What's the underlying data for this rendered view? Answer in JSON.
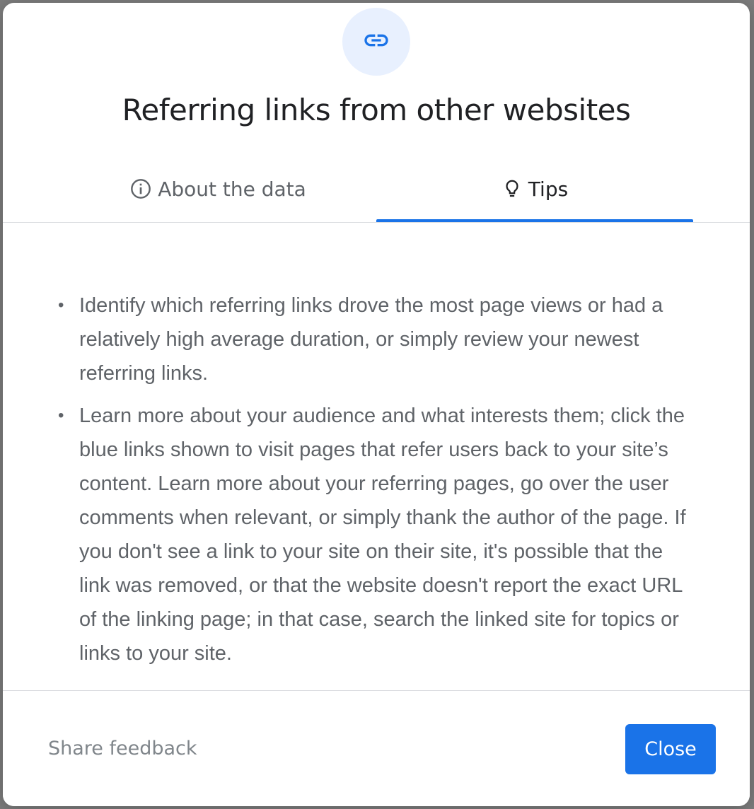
{
  "dialog": {
    "title": "Referring links from other websites",
    "header_icon": "link-icon",
    "accent_color": "#1a73e8",
    "icon_bg_color": "#e8f0fe"
  },
  "tabs": [
    {
      "label": "About the data",
      "icon": "info-icon",
      "selected": false
    },
    {
      "label": "Tips",
      "icon": "lightbulb-icon",
      "selected": true
    }
  ],
  "tips": [
    "Identify which referring links drove the most page views or had a relatively high average duration, or simply review your newest referring links.",
    "Learn more about your audience and what interests them; click the blue links shown to visit pages that refer users back to your site’s content. Learn more about your referring pages, go over the user comments when relevant, or simply thank the author of the page. If you don't see a link to your site on their site, it's possible that the link was removed, or that the website doesn't report the exact URL of the linking page; in that case, search the linked site for topics or links to your site."
  ],
  "footer": {
    "share_feedback_label": "Share feedback",
    "close_label": "Close"
  }
}
